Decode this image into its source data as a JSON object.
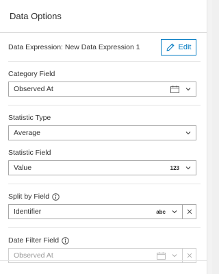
{
  "panel": {
    "title": "Data Options"
  },
  "expression": {
    "label": "Data Expression: New Data Expression 1",
    "edit_label": "Edit"
  },
  "category_field": {
    "label": "Category Field",
    "value": "Observed At",
    "type_icon": "calendar-icon"
  },
  "statistic_type": {
    "label": "Statistic Type",
    "value": "Average"
  },
  "statistic_field": {
    "label": "Statistic Field",
    "value": "Value",
    "type_badge": "123"
  },
  "split_by_field": {
    "label": "Split by Field",
    "value": "Identifier",
    "type_badge": "abc"
  },
  "date_filter_field": {
    "label": "Date Filter Field",
    "value": "Observed At",
    "type_icon": "calendar-icon",
    "disabled": true
  },
  "colors": {
    "accent": "#007ac2",
    "border": "#a8a8a8",
    "divider": "#e4e4e4"
  }
}
